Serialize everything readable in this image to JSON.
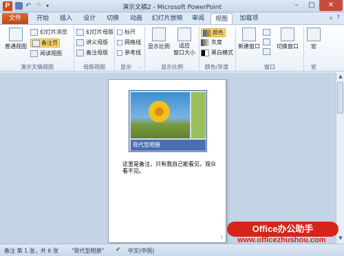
{
  "window": {
    "title": "演示文稿2 - Microsoft PowerPoint",
    "app_icon": "P",
    "controls": {
      "minimize": "–",
      "maximize": "□",
      "close": "✕"
    }
  },
  "quick_access": {
    "undo": "↶",
    "redo": "↷",
    "more": "▾"
  },
  "tabs": {
    "file": "文件",
    "items": [
      "开始",
      "插入",
      "设计",
      "切换",
      "动画",
      "幻灯片放映",
      "审阅",
      "视图",
      "加载项"
    ],
    "active": "视图",
    "right_icons": {
      "collapse": "▵",
      "help": "?"
    }
  },
  "ribbon": {
    "presentation_views": {
      "label": "演示文稿视图",
      "normal": "普通视图",
      "slide_sorter": "幻灯片浏览",
      "notes_page": "备注页",
      "reading_view": "阅读视图"
    },
    "master_views": {
      "label": "母版视图",
      "slide_master": "幻灯片母版",
      "handout_master": "讲义母版",
      "notes_master": "备注母版"
    },
    "show": {
      "label": "显示",
      "ruler": "标尺",
      "gridlines": "网格线",
      "guides": "参考线"
    },
    "zoom": {
      "label": "显示比例",
      "zoom": "显示比例",
      "fit_window_1": "适应",
      "fit_window_2": "窗口大小"
    },
    "color_grayscale": {
      "label": "颜色/灰度",
      "color": "颜色",
      "grayscale": "灰度",
      "black_white": "黑白模式"
    },
    "window": {
      "label": "窗口",
      "new_window": "新建窗口",
      "switch_windows": "切换窗口"
    },
    "macros": {
      "label": "宏",
      "macros": "宏"
    }
  },
  "slide": {
    "bar_title": "现代型相册",
    "notes_text": "这里是备注，只有我自己能看见，观众看不见。",
    "page_number": "1"
  },
  "statusbar": {
    "slide_info": "备注 第 1 张，共 6 张",
    "theme": "\"现代型相册\"",
    "language": "中文(中国)",
    "check_icon": "✔"
  },
  "watermark": {
    "logo": "Office办公助手",
    "url": "www.officezhushou.com"
  },
  "colors": {
    "file_tab": "#c94a1c",
    "ribbon_bg": "#eaf1f9",
    "workspace_bg": "#c5d3e6",
    "slide_bar": "#4b6db2",
    "watermark": "#d6241a"
  }
}
